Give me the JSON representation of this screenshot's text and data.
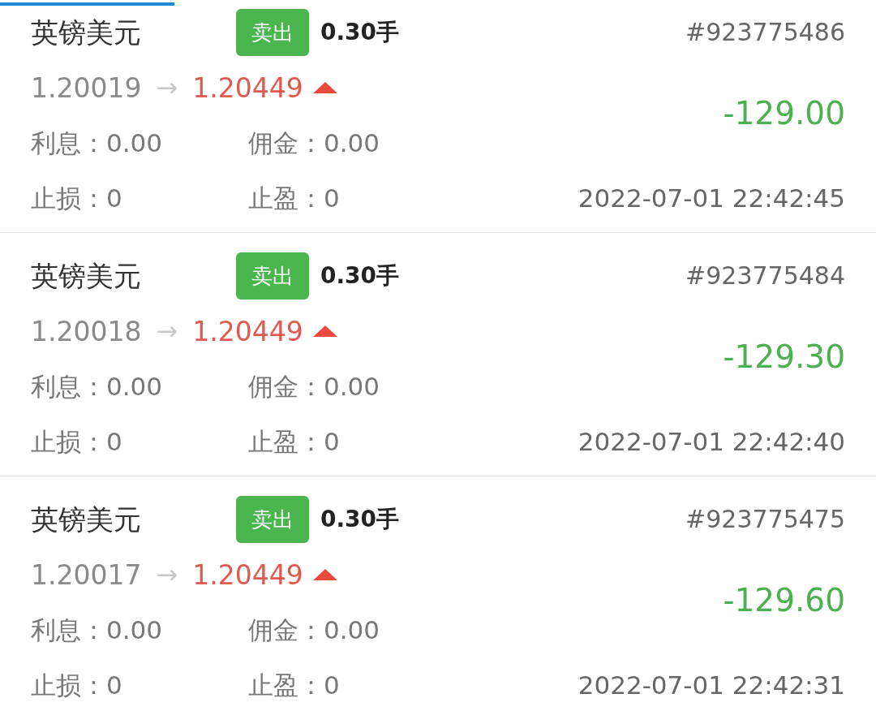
{
  "tab_indicator": {
    "selected": true
  },
  "orders": [
    {
      "symbol": "英镑美元",
      "side": "卖出",
      "lots": "0.30手",
      "order_no": "#923775486",
      "open_price": "1.20019",
      "arrow": "→",
      "current_price": "1.20449",
      "price_rising": true,
      "profit": "-129.00",
      "swap": "利息：0.00",
      "commission": "佣金：0.00",
      "stop_loss": "止损：0",
      "take_profit": "止盈：0",
      "time": "2022-07-01 22:42:45"
    },
    {
      "symbol": "英镑美元",
      "side": "卖出",
      "lots": "0.30手",
      "order_no": "#923775484",
      "open_price": "1.20018",
      "arrow": "→",
      "current_price": "1.20449",
      "price_rising": true,
      "profit": "-129.30",
      "swap": "利息：0.00",
      "commission": "佣金：0.00",
      "stop_loss": "止损：0",
      "take_profit": "止盈：0",
      "time": "2022-07-01 22:42:40"
    },
    {
      "symbol": "英镑美元",
      "side": "卖出",
      "lots": "0.30手",
      "order_no": "#923775475",
      "open_price": "1.20017",
      "arrow": "→",
      "current_price": "1.20449",
      "price_rising": true,
      "profit": "-129.60",
      "swap": "利息：0.00",
      "commission": "佣金：0.00",
      "stop_loss": "止损：0",
      "take_profit": "止盈：0",
      "time": "2022-07-01 22:42:31"
    }
  ]
}
